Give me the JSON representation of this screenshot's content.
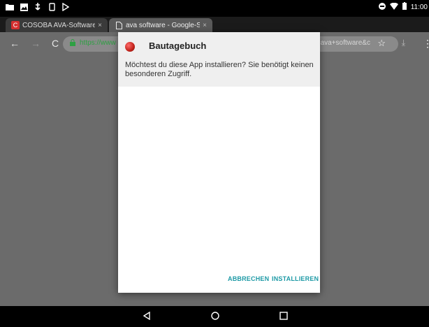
{
  "status_bar": {
    "left_icons": [
      "folder-icon",
      "image-icon",
      "usb-icon",
      "sim-icon",
      "play-store-icon"
    ],
    "time": "11:00"
  },
  "browser": {
    "tabs": [
      {
        "title": "COSOBA AVA-Software, Bau",
        "close": "×",
        "favicon_color": "#d32f2f",
        "favicon_letter": "C"
      },
      {
        "title": "ava software - Google-Suche",
        "close": "×"
      }
    ],
    "new_tab": "+",
    "url_left": "https://www",
    "url_right": "&q=ava+software&c"
  },
  "dialog": {
    "app_name": "Bautagebuch",
    "message": "Möchtest du diese App installieren? Sie benötigt keinen besonderen Zugriff.",
    "cancel_label": "ABBRECHEN",
    "install_label": "INSTALLIEREN"
  },
  "colors": {
    "accent": "#1e9aa6",
    "secure_green": "#2ea043"
  }
}
